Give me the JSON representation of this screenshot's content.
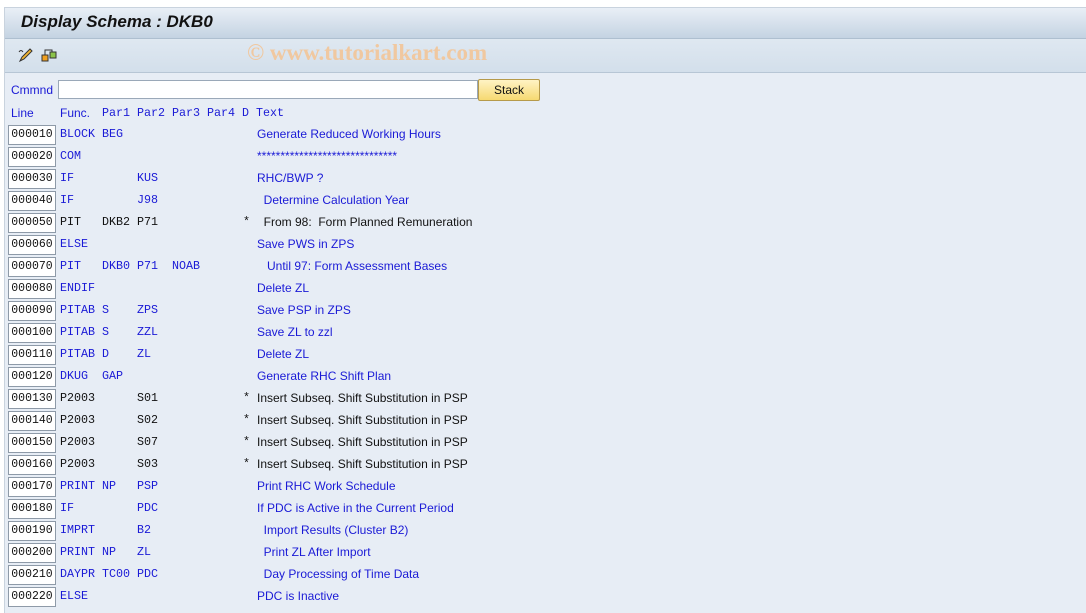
{
  "window": {
    "title": "Display Schema : DKB0"
  },
  "toolbar": {
    "icons": [
      "change-edit-icon",
      "hierarchy-icon"
    ],
    "watermark": "© www.tutorialkart.com"
  },
  "command": {
    "label": "Cmmnd",
    "value": "",
    "stack_label": "Stack"
  },
  "columns": {
    "line": "Line",
    "func": "Func.",
    "par1": "Par1",
    "par2": "Par2",
    "par3": "Par3",
    "par4": "Par4",
    "d": "D",
    "text": "Text"
  },
  "rows": [
    {
      "line": "000010",
      "func": "BLOCK",
      "par1": "BEG",
      "par2": "",
      "par3": "",
      "d": "",
      "text": "Generate Reduced Working Hours",
      "comment": false
    },
    {
      "line": "000020",
      "func": "COM",
      "par1": "",
      "par2": "",
      "par3": "",
      "d": "",
      "text": "******************************",
      "comment": false
    },
    {
      "line": "000030",
      "func": "IF",
      "par1": "",
      "par2": "KUS",
      "par3": "",
      "d": "",
      "text": "RHC/BWP ?",
      "comment": false
    },
    {
      "line": "000040",
      "func": "IF",
      "par1": "",
      "par2": "J98",
      "par3": "",
      "d": "",
      "text": "  Determine Calculation Year",
      "comment": false
    },
    {
      "line": "000050",
      "func": "PIT",
      "par1": "DKB2",
      "par2": "P71",
      "par3": "",
      "d": "*",
      "text": "  From 98:  Form Planned Remuneration",
      "comment": true
    },
    {
      "line": "000060",
      "func": "ELSE",
      "par1": "",
      "par2": "",
      "par3": "",
      "d": "",
      "text": "Save PWS in ZPS",
      "comment": false
    },
    {
      "line": "000070",
      "func": "PIT",
      "par1": "DKB0",
      "par2": "P71",
      "par3": "NOAB",
      "d": "",
      "text": "   Until 97: Form Assessment Bases",
      "comment": false
    },
    {
      "line": "000080",
      "func": "ENDIF",
      "par1": "",
      "par2": "",
      "par3": "",
      "d": "",
      "text": "Delete ZL",
      "comment": false
    },
    {
      "line": "000090",
      "func": "PITAB",
      "par1": "S",
      "par2": "ZPS",
      "par3": "",
      "d": "",
      "text": "Save PSP in ZPS",
      "comment": false
    },
    {
      "line": "000100",
      "func": "PITAB",
      "par1": "S",
      "par2": "ZZL",
      "par3": "",
      "d": "",
      "text": "Save ZL to zzl",
      "comment": false
    },
    {
      "line": "000110",
      "func": "PITAB",
      "par1": "D",
      "par2": "ZL",
      "par3": "",
      "d": "",
      "text": "Delete ZL",
      "comment": false
    },
    {
      "line": "000120",
      "func": "DKUG",
      "par1": "GAP",
      "par2": "",
      "par3": "",
      "d": "",
      "text": "Generate RHC Shift Plan",
      "comment": false
    },
    {
      "line": "000130",
      "func": "P2003",
      "par1": "",
      "par2": "S01",
      "par3": "",
      "d": "*",
      "text": "Insert Subseq. Shift Substitution in PSP",
      "comment": true
    },
    {
      "line": "000140",
      "func": "P2003",
      "par1": "",
      "par2": "S02",
      "par3": "",
      "d": "*",
      "text": "Insert Subseq. Shift Substitution in PSP",
      "comment": true
    },
    {
      "line": "000150",
      "func": "P2003",
      "par1": "",
      "par2": "S07",
      "par3": "",
      "d": "*",
      "text": "Insert Subseq. Shift Substitution in PSP",
      "comment": true
    },
    {
      "line": "000160",
      "func": "P2003",
      "par1": "",
      "par2": "S03",
      "par3": "",
      "d": "*",
      "text": "Insert Subseq. Shift Substitution in PSP",
      "comment": true
    },
    {
      "line": "000170",
      "func": "PRINT",
      "par1": "NP",
      "par2": "PSP",
      "par3": "",
      "d": "",
      "text": "Print RHC Work Schedule",
      "comment": false
    },
    {
      "line": "000180",
      "func": "IF",
      "par1": "",
      "par2": "PDC",
      "par3": "",
      "d": "",
      "text": "If PDC is Active in the Current Period",
      "comment": false
    },
    {
      "line": "000190",
      "func": "IMPRT",
      "par1": "",
      "par2": "B2",
      "par3": "",
      "d": "",
      "text": "  Import Results (Cluster B2)",
      "comment": false
    },
    {
      "line": "000200",
      "func": "PRINT",
      "par1": "NP",
      "par2": "ZL",
      "par3": "",
      "d": "",
      "text": "  Print ZL After Import",
      "comment": false
    },
    {
      "line": "000210",
      "func": "DAYPR",
      "par1": "TC00",
      "par2": "PDC",
      "par3": "",
      "d": "",
      "text": "  Day Processing of Time Data",
      "comment": false
    },
    {
      "line": "000220",
      "func": "ELSE",
      "par1": "",
      "par2": "",
      "par3": "",
      "d": "",
      "text": "PDC is Inactive",
      "comment": false
    }
  ]
}
